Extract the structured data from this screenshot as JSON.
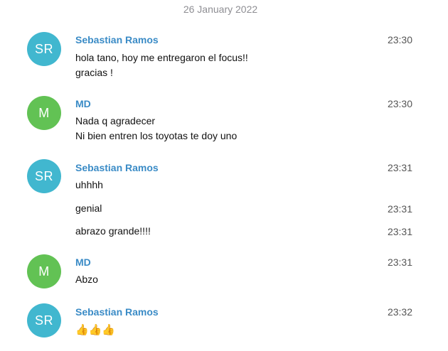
{
  "chat": {
    "date_header": "26 January 2022",
    "colors": {
      "sr_avatar": "#41b7cf",
      "md_avatar": "#62c254",
      "sender_name": "#3a8bc6"
    },
    "groups": [
      {
        "avatar_initials": "SR",
        "sender": "Sebastian Ramos",
        "time": "23:30",
        "lines": [
          "hola tano, hoy me entregaron el focus!!",
          "gracias !"
        ]
      },
      {
        "avatar_initials": "M",
        "sender": "MD",
        "time": "23:30",
        "lines": [
          "Nada q agradecer",
          "Ni bien entren los toyotas te doy uno"
        ]
      },
      {
        "avatar_initials": "SR",
        "sender": "Sebastian Ramos",
        "time": "23:31",
        "lines": [
          "uhhhh"
        ],
        "followups": [
          {
            "text": "genial",
            "time": "23:31"
          },
          {
            "text": "abrazo grande!!!!",
            "time": "23:31"
          }
        ]
      },
      {
        "avatar_initials": "M",
        "sender": "MD",
        "time": "23:31",
        "lines": [
          "Abzo"
        ]
      },
      {
        "avatar_initials": "SR",
        "sender": "Sebastian Ramos",
        "time": "23:32",
        "lines": [
          "👍👍👍"
        ],
        "icon": "thumbs-up-emoji"
      }
    ]
  }
}
